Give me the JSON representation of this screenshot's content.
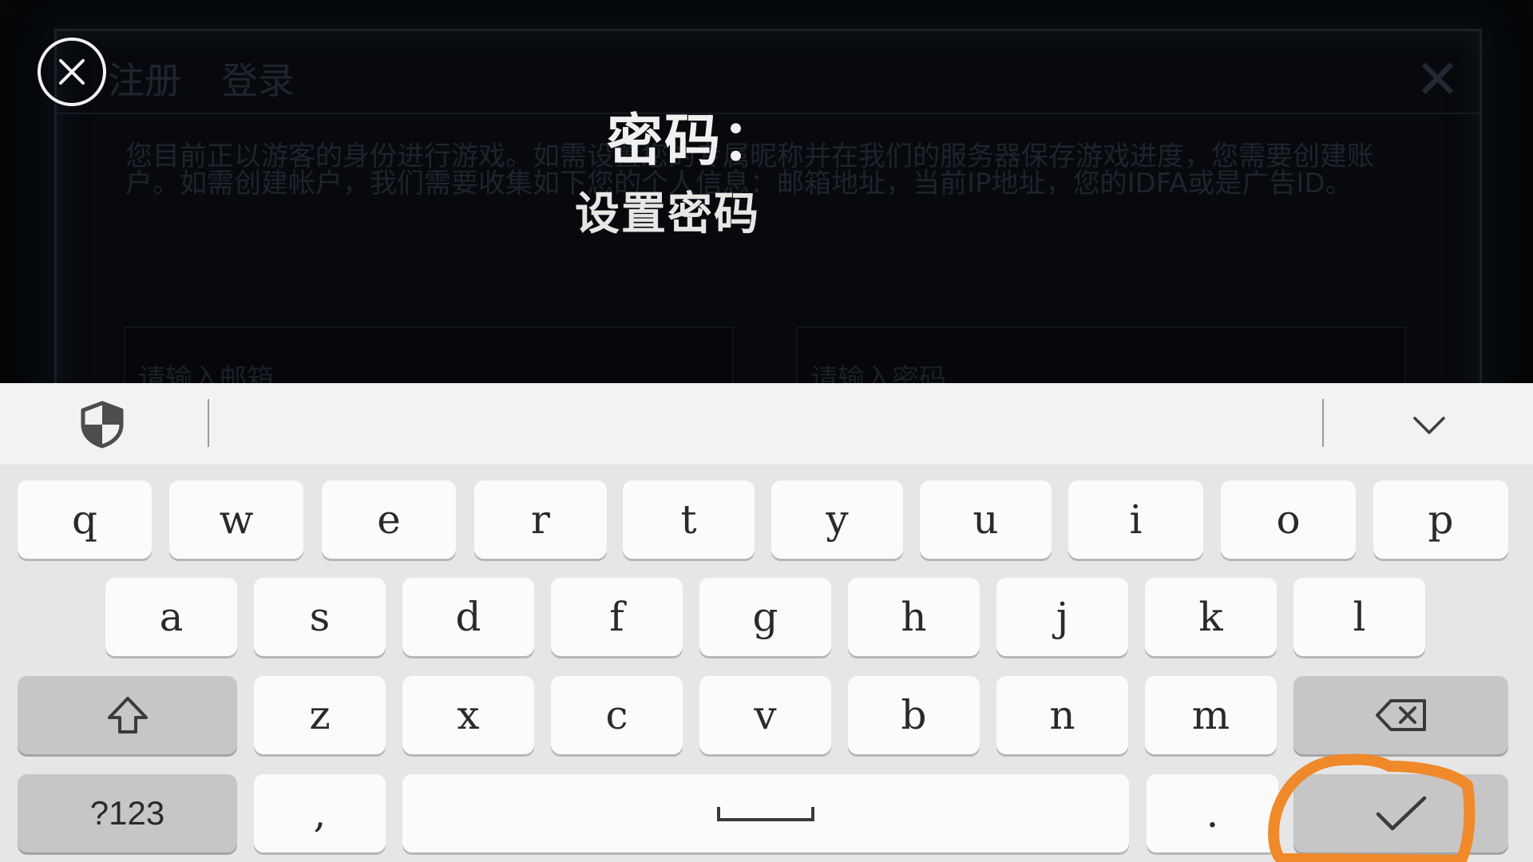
{
  "dialog": {
    "tabs": [
      "注册",
      "登录"
    ],
    "close_glyph": "✕",
    "notice": "您目前正以游客的身份进行游戏。如需设置您的专属昵称并在我们的服务器保存游戏进度，您需要创建账户。如需创建帐户，我们需要收集如下您的个人信息：邮箱地址，当前IP地址，您的IDFA或是广告ID。",
    "email_placeholder": "请输入邮箱",
    "password_placeholder": "请输入密码"
  },
  "overlay": {
    "title": "密码：",
    "subtitle": "设置密码"
  },
  "keyboard": {
    "row1": [
      "q",
      "w",
      "e",
      "r",
      "t",
      "y",
      "u",
      "i",
      "o",
      "p"
    ],
    "row2": [
      "a",
      "s",
      "d",
      "f",
      "g",
      "h",
      "j",
      "k",
      "l"
    ],
    "row3": [
      "z",
      "x",
      "c",
      "v",
      "b",
      "n",
      "m"
    ],
    "symbols_label": "?123",
    "comma_label": ",",
    "period_label": ".",
    "icons": {
      "shield": "shield-icon",
      "collapse": "chevron-down-icon",
      "shift": "shift-icon",
      "backspace": "backspace-icon",
      "space": "space-icon",
      "enter": "checkmark-icon"
    }
  },
  "colors": {
    "annotation": "#f0892a",
    "key_face": "#fbfbfb",
    "function_key": "#c6c6c6",
    "keyboard_bg": "#e6e6e6"
  }
}
